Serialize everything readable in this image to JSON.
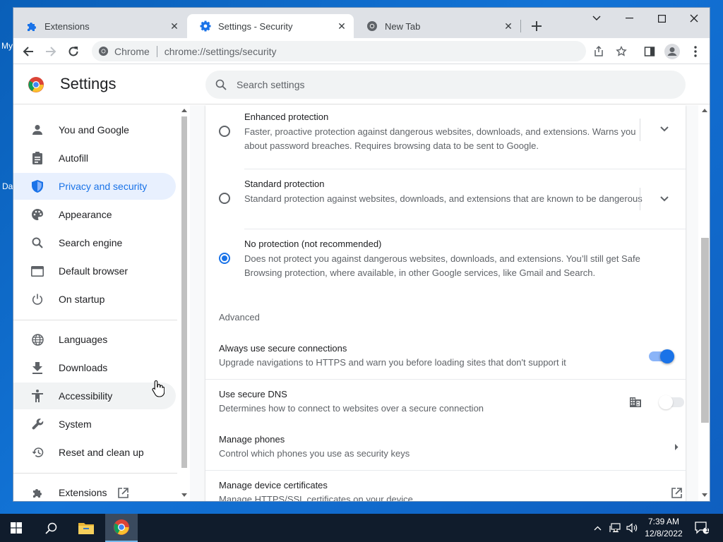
{
  "desktop": {
    "frag_top": "My",
    "frag_bottom": "Da"
  },
  "tabs": [
    {
      "label": "Extensions",
      "icon": "puzzle-icon",
      "active": false
    },
    {
      "label": "Settings - Security",
      "icon": "gear-icon",
      "active": true
    },
    {
      "label": "New Tab",
      "icon": "chrome-icon",
      "active": false
    }
  ],
  "toolbar": {
    "site_label": "Chrome",
    "url": "chrome://settings/security"
  },
  "settings": {
    "title": "Settings",
    "search_placeholder": "Search settings"
  },
  "sidebar": {
    "items": [
      {
        "label": "You and Google",
        "icon": "person-icon"
      },
      {
        "label": "Autofill",
        "icon": "clipboard-icon"
      },
      {
        "label": "Privacy and security",
        "icon": "shield-icon"
      },
      {
        "label": "Appearance",
        "icon": "palette-icon"
      },
      {
        "label": "Search engine",
        "icon": "search-icon"
      },
      {
        "label": "Default browser",
        "icon": "browser-icon"
      },
      {
        "label": "On startup",
        "icon": "power-icon"
      },
      {
        "label": "Languages",
        "icon": "globe-icon"
      },
      {
        "label": "Downloads",
        "icon": "download-icon"
      },
      {
        "label": "Accessibility",
        "icon": "accessibility-icon"
      },
      {
        "label": "System",
        "icon": "wrench-icon"
      },
      {
        "label": "Reset and clean up",
        "icon": "restore-icon"
      },
      {
        "label": "Extensions",
        "icon": "puzzle-icon"
      }
    ],
    "active_item": "Privacy and security"
  },
  "security": {
    "options": [
      {
        "title": "Enhanced protection",
        "description": "Faster, proactive protection against dangerous websites, downloads, and extensions. Warns you about password breaches. Requires browsing data to be sent to Google.",
        "selected": false
      },
      {
        "title": "Standard protection",
        "description": "Standard protection against websites, downloads, and extensions that are known to be dangerous",
        "selected": false
      },
      {
        "title": "No protection (not recommended)",
        "description": "Does not protect you against dangerous websites, downloads, and extensions. You’ll still get Safe Browsing protection, where available, in other Google services, like Gmail and Search.",
        "selected": true
      }
    ],
    "advanced_heading": "Advanced",
    "https": {
      "title": "Always use secure connections",
      "description": "Upgrade navigations to HTTPS and warn you before loading sites that don't support it",
      "enabled": true
    },
    "dns": {
      "title": "Use secure DNS",
      "description": "Determines how to connect to websites over a secure connection",
      "enabled": false
    },
    "phones": {
      "title": "Manage phones",
      "description": "Control which phones you use as security keys"
    },
    "certs": {
      "title": "Manage device certificates",
      "description": "Manage HTTPS/SSL certificates on your device"
    }
  },
  "taskbar": {
    "time": "7:39 AM",
    "date": "12/8/2022",
    "notification_count": "1"
  },
  "colors": {
    "accent": "#1a73e8",
    "active_nav_bg": "#e8f0fe",
    "taskbar": "#101c2c"
  }
}
